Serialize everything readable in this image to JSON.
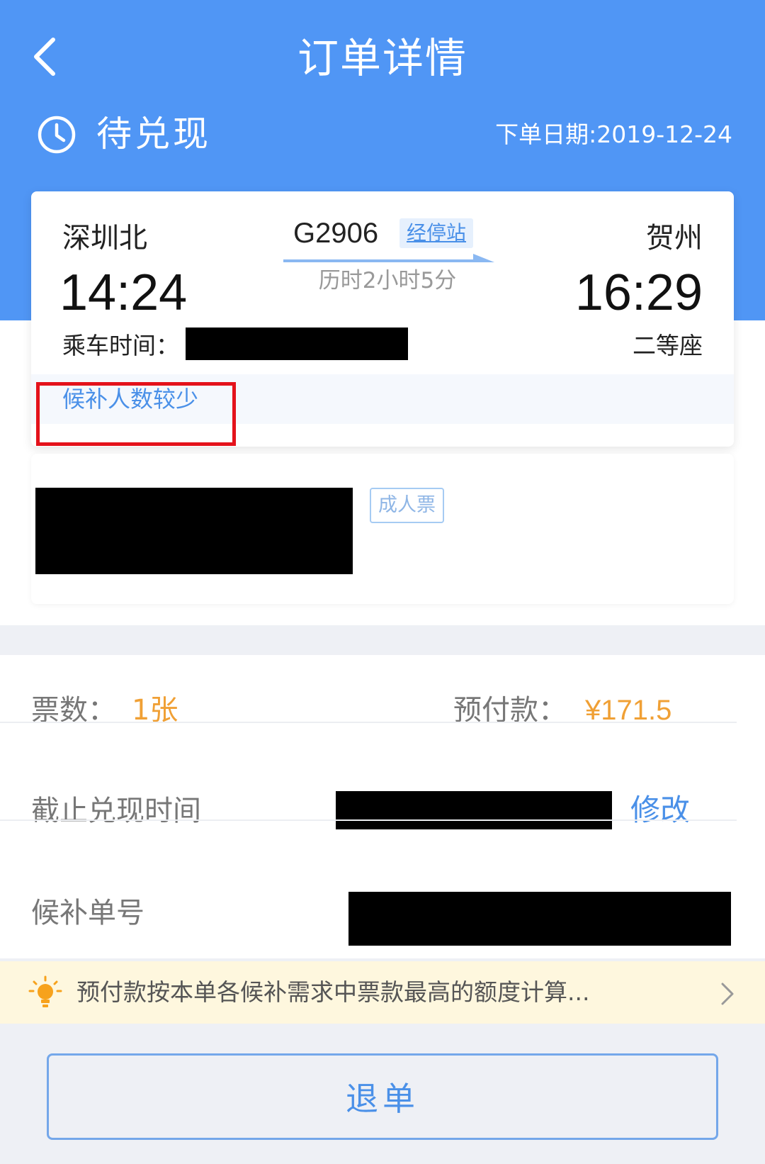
{
  "header": {
    "title": "订单详情",
    "status": "待兑现",
    "order_date": "下单日期:2019-12-24"
  },
  "trip": {
    "from_station": "深圳北",
    "from_time": "14:24",
    "to_station": "贺州",
    "to_time": "16:29",
    "train_no": "G2906",
    "stops_link": "经停站",
    "duration": "历时2小时5分",
    "ride_time_label": "乘车时间：",
    "seat_class": "二等座",
    "tip": "候补人数较少"
  },
  "passenger": {
    "ticket_type": "成人票"
  },
  "summary": {
    "ticket_count_label": "票数：",
    "ticket_count": "1张",
    "prepay_label": "预付款：",
    "prepay_amount": "¥171.5",
    "deadline_label": "截止兑现时间",
    "modify": "修改",
    "order_no_label": "候补单号"
  },
  "notice": {
    "text": "预付款按本单各候补需求中票款最高的额度计算..."
  },
  "actions": {
    "refund": "退单"
  },
  "colors": {
    "primary_blue": "#5096f5",
    "link_blue": "#4a90e8",
    "price_orange": "#f0a035",
    "notice_bg": "#fef7de",
    "highlight_red": "#e4121b"
  },
  "icons": [
    "back-arrow-icon",
    "clock-icon",
    "route-arrow-icon",
    "lightbulb-icon",
    "chevron-right-icon"
  ]
}
